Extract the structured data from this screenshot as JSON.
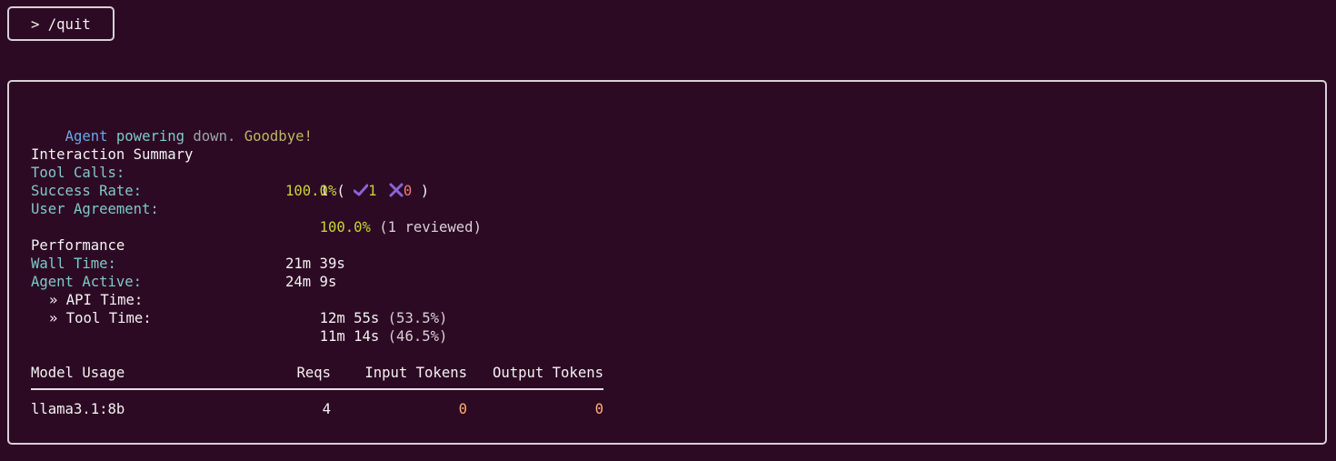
{
  "command": {
    "text": "> /quit"
  },
  "goodbye": {
    "word1": "Agent",
    "word2": "powering",
    "word3": "down.",
    "word4": "Goodbye!"
  },
  "interaction": {
    "heading": "Interaction Summary",
    "tool_calls_label": "Tool Calls:",
    "tool_calls_total": "1",
    "open_paren": "(",
    "close_paren": ")",
    "success_count": "1",
    "fail_count": "0",
    "success_rate_label": "Success Rate:",
    "success_rate_value": "100.0%",
    "agreement_label": "User Agreement:",
    "agreement_value": "100.0%",
    "agreement_note": "(1 reviewed)"
  },
  "performance": {
    "heading": "Performance",
    "wall_label": "Wall Time:",
    "wall_value": "21m 39s",
    "active_label": "Agent Active:",
    "active_value": "24m 9s",
    "api_label": "» API Time:",
    "api_value": "12m 55s",
    "api_pct": "(53.5%)",
    "tool_label": "» Tool Time:",
    "tool_value": "11m 14s",
    "tool_pct": "(46.5%)"
  },
  "usage": {
    "headers": {
      "model": "Model Usage",
      "reqs": "Reqs",
      "input": "Input Tokens",
      "output": "Output Tokens"
    },
    "rows": [
      {
        "model": "llama3.1:8b",
        "reqs": "4",
        "input": "0",
        "output": "0"
      }
    ]
  },
  "colors": {
    "background": "#2d0a24",
    "label": "#7fc8c8",
    "success": "#c6d630",
    "fail": "#f07a7a",
    "tokens": "#ffb070"
  }
}
